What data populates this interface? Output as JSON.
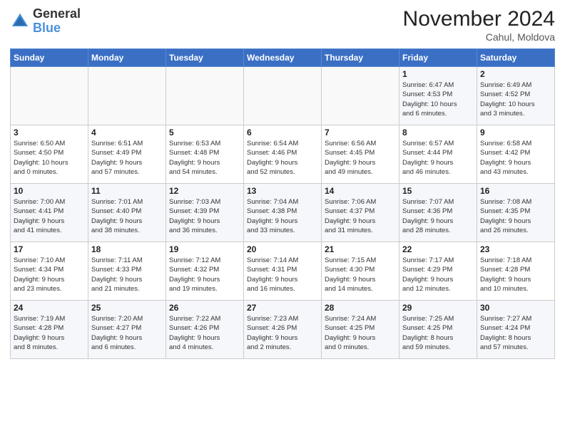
{
  "header": {
    "logo_general": "General",
    "logo_blue": "Blue",
    "month_title": "November 2024",
    "location": "Cahul, Moldova"
  },
  "weekdays": [
    "Sunday",
    "Monday",
    "Tuesday",
    "Wednesday",
    "Thursday",
    "Friday",
    "Saturday"
  ],
  "weeks": [
    [
      {
        "day": "",
        "info": ""
      },
      {
        "day": "",
        "info": ""
      },
      {
        "day": "",
        "info": ""
      },
      {
        "day": "",
        "info": ""
      },
      {
        "day": "",
        "info": ""
      },
      {
        "day": "1",
        "info": "Sunrise: 6:47 AM\nSunset: 4:53 PM\nDaylight: 10 hours\nand 6 minutes."
      },
      {
        "day": "2",
        "info": "Sunrise: 6:49 AM\nSunset: 4:52 PM\nDaylight: 10 hours\nand 3 minutes."
      }
    ],
    [
      {
        "day": "3",
        "info": "Sunrise: 6:50 AM\nSunset: 4:50 PM\nDaylight: 10 hours\nand 0 minutes."
      },
      {
        "day": "4",
        "info": "Sunrise: 6:51 AM\nSunset: 4:49 PM\nDaylight: 9 hours\nand 57 minutes."
      },
      {
        "day": "5",
        "info": "Sunrise: 6:53 AM\nSunset: 4:48 PM\nDaylight: 9 hours\nand 54 minutes."
      },
      {
        "day": "6",
        "info": "Sunrise: 6:54 AM\nSunset: 4:46 PM\nDaylight: 9 hours\nand 52 minutes."
      },
      {
        "day": "7",
        "info": "Sunrise: 6:56 AM\nSunset: 4:45 PM\nDaylight: 9 hours\nand 49 minutes."
      },
      {
        "day": "8",
        "info": "Sunrise: 6:57 AM\nSunset: 4:44 PM\nDaylight: 9 hours\nand 46 minutes."
      },
      {
        "day": "9",
        "info": "Sunrise: 6:58 AM\nSunset: 4:42 PM\nDaylight: 9 hours\nand 43 minutes."
      }
    ],
    [
      {
        "day": "10",
        "info": "Sunrise: 7:00 AM\nSunset: 4:41 PM\nDaylight: 9 hours\nand 41 minutes."
      },
      {
        "day": "11",
        "info": "Sunrise: 7:01 AM\nSunset: 4:40 PM\nDaylight: 9 hours\nand 38 minutes."
      },
      {
        "day": "12",
        "info": "Sunrise: 7:03 AM\nSunset: 4:39 PM\nDaylight: 9 hours\nand 36 minutes."
      },
      {
        "day": "13",
        "info": "Sunrise: 7:04 AM\nSunset: 4:38 PM\nDaylight: 9 hours\nand 33 minutes."
      },
      {
        "day": "14",
        "info": "Sunrise: 7:06 AM\nSunset: 4:37 PM\nDaylight: 9 hours\nand 31 minutes."
      },
      {
        "day": "15",
        "info": "Sunrise: 7:07 AM\nSunset: 4:36 PM\nDaylight: 9 hours\nand 28 minutes."
      },
      {
        "day": "16",
        "info": "Sunrise: 7:08 AM\nSunset: 4:35 PM\nDaylight: 9 hours\nand 26 minutes."
      }
    ],
    [
      {
        "day": "17",
        "info": "Sunrise: 7:10 AM\nSunset: 4:34 PM\nDaylight: 9 hours\nand 23 minutes."
      },
      {
        "day": "18",
        "info": "Sunrise: 7:11 AM\nSunset: 4:33 PM\nDaylight: 9 hours\nand 21 minutes."
      },
      {
        "day": "19",
        "info": "Sunrise: 7:12 AM\nSunset: 4:32 PM\nDaylight: 9 hours\nand 19 minutes."
      },
      {
        "day": "20",
        "info": "Sunrise: 7:14 AM\nSunset: 4:31 PM\nDaylight: 9 hours\nand 16 minutes."
      },
      {
        "day": "21",
        "info": "Sunrise: 7:15 AM\nSunset: 4:30 PM\nDaylight: 9 hours\nand 14 minutes."
      },
      {
        "day": "22",
        "info": "Sunrise: 7:17 AM\nSunset: 4:29 PM\nDaylight: 9 hours\nand 12 minutes."
      },
      {
        "day": "23",
        "info": "Sunrise: 7:18 AM\nSunset: 4:28 PM\nDaylight: 9 hours\nand 10 minutes."
      }
    ],
    [
      {
        "day": "24",
        "info": "Sunrise: 7:19 AM\nSunset: 4:28 PM\nDaylight: 9 hours\nand 8 minutes."
      },
      {
        "day": "25",
        "info": "Sunrise: 7:20 AM\nSunset: 4:27 PM\nDaylight: 9 hours\nand 6 minutes."
      },
      {
        "day": "26",
        "info": "Sunrise: 7:22 AM\nSunset: 4:26 PM\nDaylight: 9 hours\nand 4 minutes."
      },
      {
        "day": "27",
        "info": "Sunrise: 7:23 AM\nSunset: 4:26 PM\nDaylight: 9 hours\nand 2 minutes."
      },
      {
        "day": "28",
        "info": "Sunrise: 7:24 AM\nSunset: 4:25 PM\nDaylight: 9 hours\nand 0 minutes."
      },
      {
        "day": "29",
        "info": "Sunrise: 7:25 AM\nSunset: 4:25 PM\nDaylight: 8 hours\nand 59 minutes."
      },
      {
        "day": "30",
        "info": "Sunrise: 7:27 AM\nSunset: 4:24 PM\nDaylight: 8 hours\nand 57 minutes."
      }
    ]
  ]
}
